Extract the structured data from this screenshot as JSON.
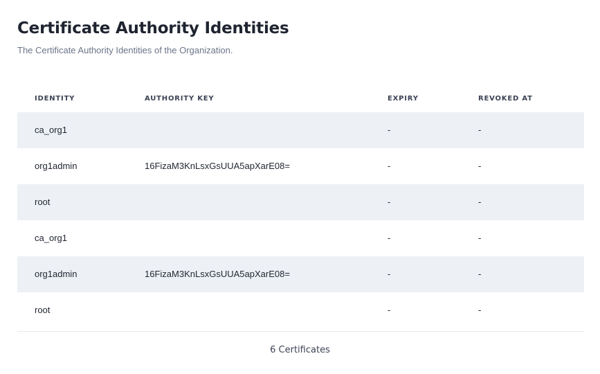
{
  "page": {
    "title": "Certificate Authority Identities",
    "subtitle": "The Certificate Authority Identities of the Organization."
  },
  "table": {
    "headers": {
      "identity": "IDENTITY",
      "authority_key": "AUTHORITY KEY",
      "expiry": "EXPIRY",
      "revoked_at": "REVOKED AT"
    },
    "rows": [
      {
        "identity": "ca_org1",
        "authority_key": "",
        "expiry": "-",
        "revoked_at": "-"
      },
      {
        "identity": "org1admin",
        "authority_key": "16FizaM3KnLsxGsUUA5apXarE08=",
        "expiry": "-",
        "revoked_at": "-"
      },
      {
        "identity": "root",
        "authority_key": "",
        "expiry": "-",
        "revoked_at": "-"
      },
      {
        "identity": "ca_org1",
        "authority_key": "",
        "expiry": "-",
        "revoked_at": "-"
      },
      {
        "identity": "org1admin",
        "authority_key": "16FizaM3KnLsxGsUUA5apXarE08=",
        "expiry": "-",
        "revoked_at": "-"
      },
      {
        "identity": "root",
        "authority_key": "",
        "expiry": "-",
        "revoked_at": "-"
      }
    ]
  },
  "footer": {
    "count_label": "6 Certificates"
  }
}
